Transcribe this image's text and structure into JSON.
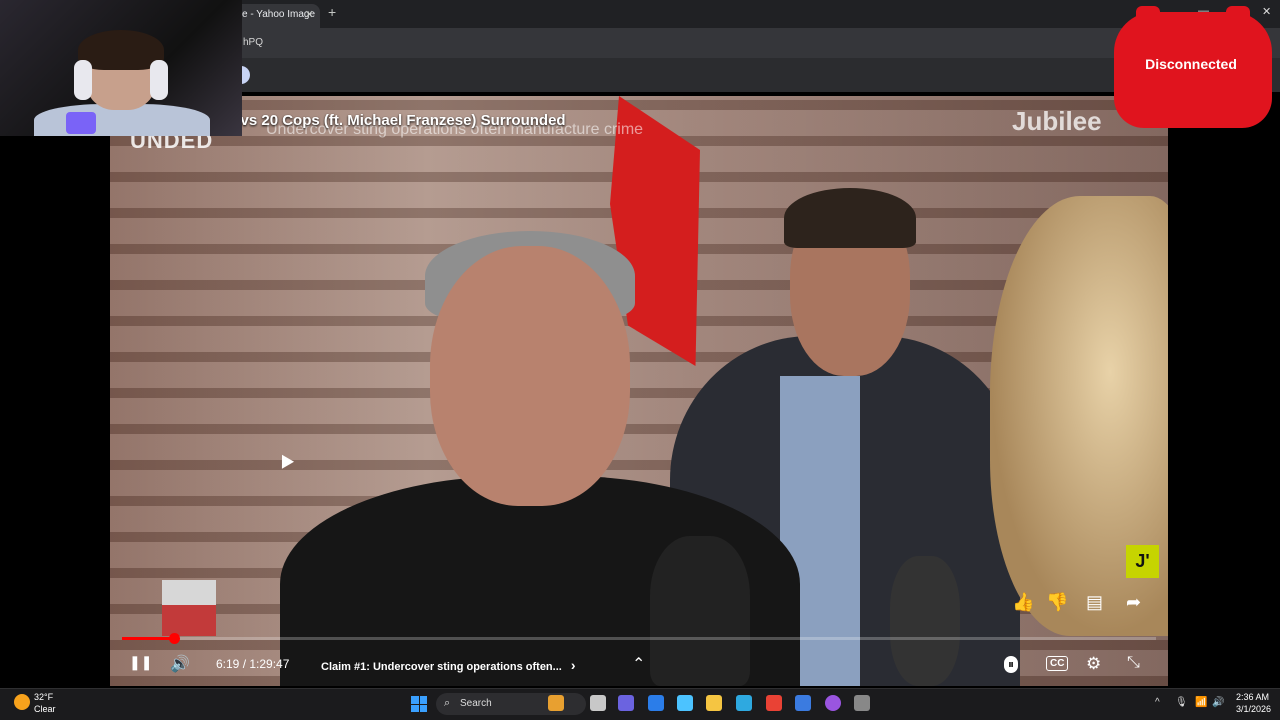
{
  "browser": {
    "tab_title": "e - Yahoo Image",
    "tab_close": "✕",
    "new_tab": "+",
    "address_fragment": "hPQ",
    "window_controls": [
      "—",
      "❐",
      "✕"
    ]
  },
  "overlay": {
    "disconnected_label": "Disconnected"
  },
  "video": {
    "title": "s vs 20 Cops (ft. Michael Franzese) Surrounded",
    "subtitle_watermark": "Undercover sting operations often manufacture crime",
    "left_watermark": "UNDED",
    "brand_watermark": "Jubilee",
    "channel_badge": "J'",
    "progress_fraction": 0.05,
    "time_display": "6:19 / 1:29:47",
    "chapter_title": "Claim #1: Undercover sting operations often...",
    "chapter_chevron": "›",
    "actions": {
      "like_icon": "👍",
      "dislike_icon": "👎",
      "comment_icon": "▤",
      "share_icon": "➦"
    },
    "controls": {
      "pause_icon": "❚❚",
      "volume_icon": "🔊",
      "expand_icon": "⌃",
      "autoplay_icon": "⏸",
      "cc_label": "CC",
      "settings_icon": "⚙",
      "exit_fullscreen_icon": "⤡"
    }
  },
  "taskbar": {
    "weather_temp": "32°F",
    "weather_condition": "Clear",
    "search_label": "Search",
    "search_glyph": "⌕",
    "tray_icons": [
      "^",
      "🎙",
      "📶",
      "🔊"
    ],
    "time": "2:36 AM",
    "date": "3/1/2026",
    "app_colors": [
      "#e8a030",
      "#c8c8c8",
      "#6b63e0",
      "#2b7de9",
      "#4cc3ff",
      "#f5c542",
      "#2ea9e0",
      "#e94235",
      "#3b7be0",
      "#9a55e0",
      "#888888"
    ]
  }
}
